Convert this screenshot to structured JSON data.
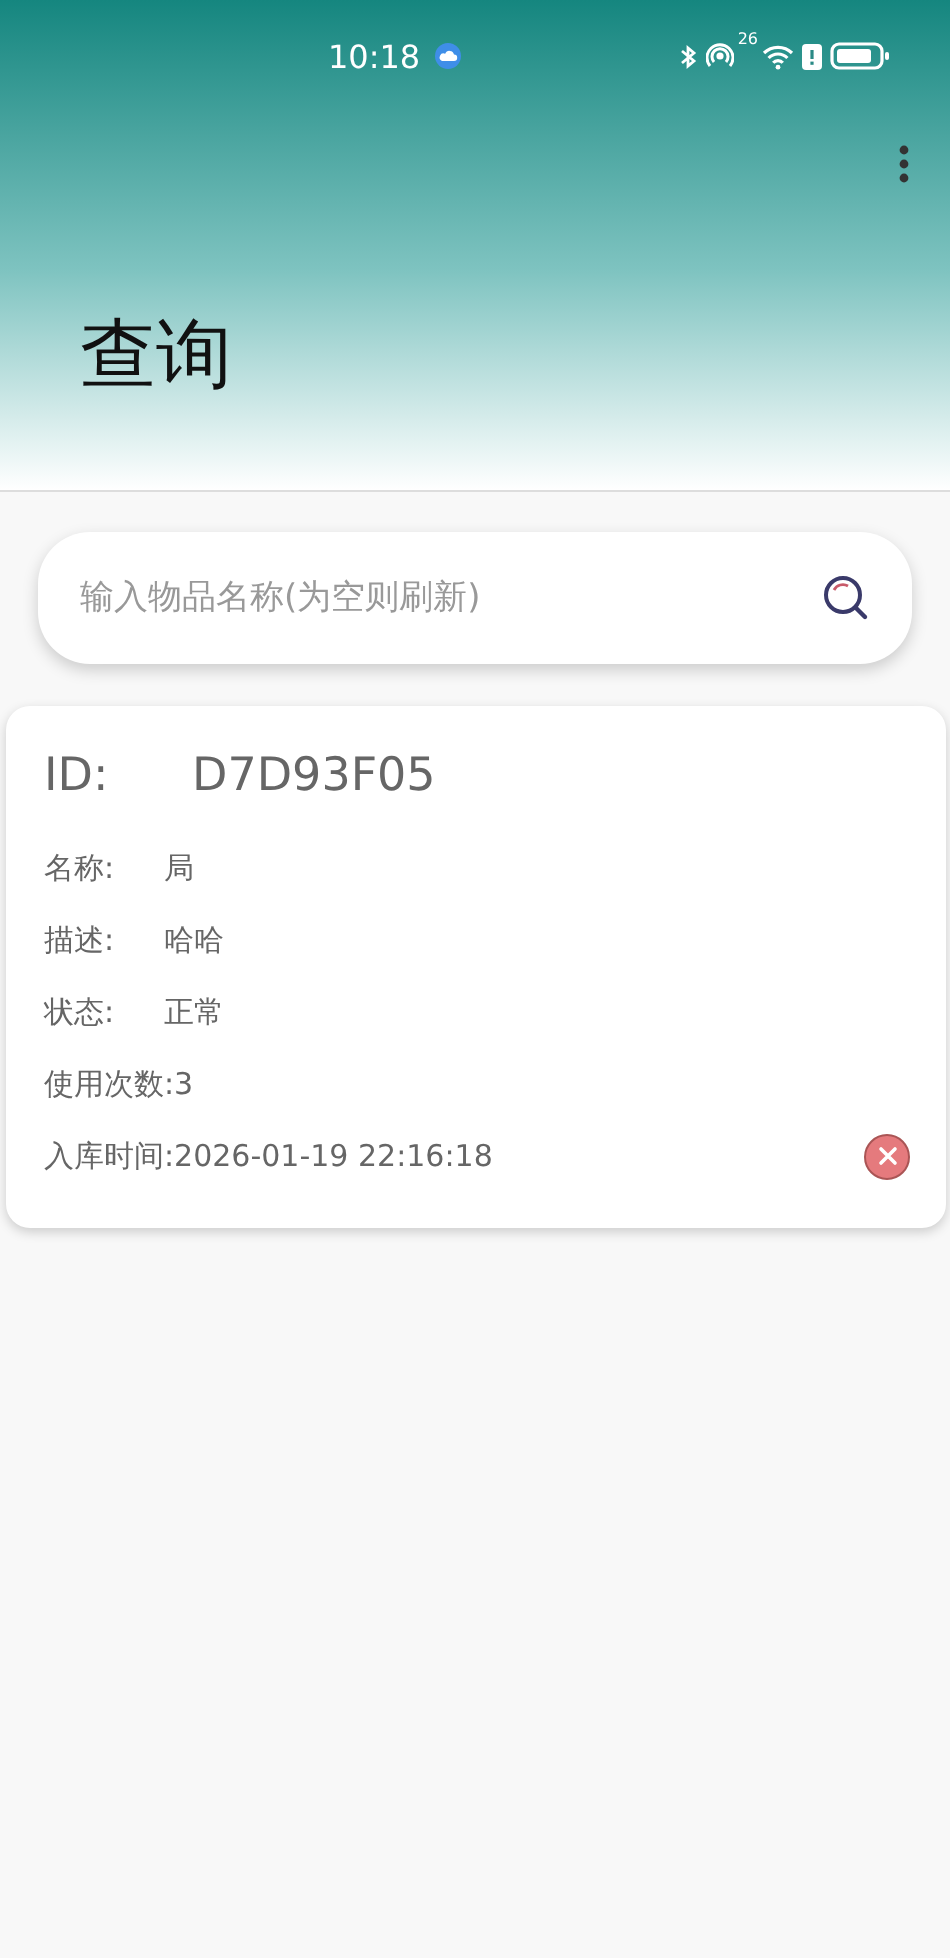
{
  "status_bar": {
    "time": "10:18",
    "hotspot_badge": "2",
    "wifi_badge": "6"
  },
  "page": {
    "title": "查询"
  },
  "search": {
    "placeholder": "输入物品名称(为空则刷新)"
  },
  "items": [
    {
      "id_label": "ID:",
      "id_value": "D7D93F05",
      "fields": [
        {
          "label": "名称:",
          "value": "局"
        },
        {
          "label": "描述:",
          "value": "哈哈"
        },
        {
          "label": "状态:",
          "value": "正常"
        }
      ],
      "usage": "使用次数:3",
      "stored_time": "入库时间:2026-01-19 22:16:18"
    }
  ]
}
